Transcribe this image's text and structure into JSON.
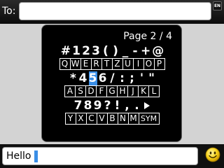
{
  "to_bar": {
    "label": "To:",
    "input_value": "",
    "language_badge": "EN"
  },
  "picker": {
    "page_label": "Page 2 / 4",
    "selected_symbol": "5",
    "rows": [
      {
        "symbols": [
          "#",
          "1",
          "2",
          "3",
          "(",
          ")",
          "_",
          "-",
          "+",
          "@"
        ],
        "keys": [
          "Q",
          "W",
          "E",
          "R",
          "T",
          "Z",
          "U",
          "I",
          "O",
          "P"
        ]
      },
      {
        "symbols": [
          "*",
          "4",
          "5",
          "6",
          "/",
          ":",
          ";",
          "'",
          "\""
        ],
        "keys": [
          "A",
          "S",
          "D",
          "F",
          "G",
          "H",
          "J",
          "K",
          "L"
        ]
      },
      {
        "symbols": [
          "7",
          "8",
          "9",
          "?",
          "!",
          ",",
          "."
        ],
        "keys": [
          "Y",
          "X",
          "C",
          "V",
          "B",
          "N",
          "M",
          "SYM"
        ]
      }
    ]
  },
  "message": {
    "value": "Hello",
    "cursor_color": "#3a8ee6"
  },
  "colors": {
    "accent": "#3a8ee6",
    "background": "#d3d3d3",
    "panel": "#000000"
  },
  "icons": {
    "emoticon": "smiley-icon",
    "next_page": "triangle-right-icon"
  }
}
